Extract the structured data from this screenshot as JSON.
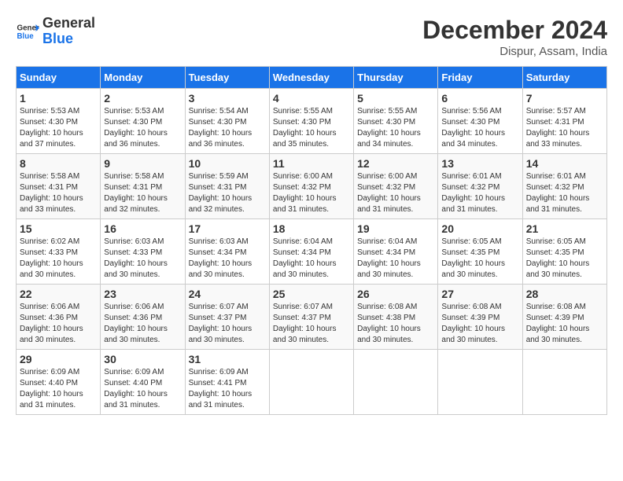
{
  "logo": {
    "line1": "General",
    "line2": "Blue"
  },
  "title": "December 2024",
  "subtitle": "Dispur, Assam, India",
  "days_header": [
    "Sunday",
    "Monday",
    "Tuesday",
    "Wednesday",
    "Thursday",
    "Friday",
    "Saturday"
  ],
  "weeks": [
    [
      {
        "day": "1",
        "sunrise": "5:53 AM",
        "sunset": "4:30 PM",
        "daylight": "10 hours and 37 minutes."
      },
      {
        "day": "2",
        "sunrise": "5:53 AM",
        "sunset": "4:30 PM",
        "daylight": "10 hours and 36 minutes."
      },
      {
        "day": "3",
        "sunrise": "5:54 AM",
        "sunset": "4:30 PM",
        "daylight": "10 hours and 36 minutes."
      },
      {
        "day": "4",
        "sunrise": "5:55 AM",
        "sunset": "4:30 PM",
        "daylight": "10 hours and 35 minutes."
      },
      {
        "day": "5",
        "sunrise": "5:55 AM",
        "sunset": "4:30 PM",
        "daylight": "10 hours and 34 minutes."
      },
      {
        "day": "6",
        "sunrise": "5:56 AM",
        "sunset": "4:30 PM",
        "daylight": "10 hours and 34 minutes."
      },
      {
        "day": "7",
        "sunrise": "5:57 AM",
        "sunset": "4:31 PM",
        "daylight": "10 hours and 33 minutes."
      }
    ],
    [
      {
        "day": "8",
        "sunrise": "5:58 AM",
        "sunset": "4:31 PM",
        "daylight": "10 hours and 33 minutes."
      },
      {
        "day": "9",
        "sunrise": "5:58 AM",
        "sunset": "4:31 PM",
        "daylight": "10 hours and 32 minutes."
      },
      {
        "day": "10",
        "sunrise": "5:59 AM",
        "sunset": "4:31 PM",
        "daylight": "10 hours and 32 minutes."
      },
      {
        "day": "11",
        "sunrise": "6:00 AM",
        "sunset": "4:32 PM",
        "daylight": "10 hours and 31 minutes."
      },
      {
        "day": "12",
        "sunrise": "6:00 AM",
        "sunset": "4:32 PM",
        "daylight": "10 hours and 31 minutes."
      },
      {
        "day": "13",
        "sunrise": "6:01 AM",
        "sunset": "4:32 PM",
        "daylight": "10 hours and 31 minutes."
      },
      {
        "day": "14",
        "sunrise": "6:01 AM",
        "sunset": "4:32 PM",
        "daylight": "10 hours and 31 minutes."
      }
    ],
    [
      {
        "day": "15",
        "sunrise": "6:02 AM",
        "sunset": "4:33 PM",
        "daylight": "10 hours and 30 minutes."
      },
      {
        "day": "16",
        "sunrise": "6:03 AM",
        "sunset": "4:33 PM",
        "daylight": "10 hours and 30 minutes."
      },
      {
        "day": "17",
        "sunrise": "6:03 AM",
        "sunset": "4:34 PM",
        "daylight": "10 hours and 30 minutes."
      },
      {
        "day": "18",
        "sunrise": "6:04 AM",
        "sunset": "4:34 PM",
        "daylight": "10 hours and 30 minutes."
      },
      {
        "day": "19",
        "sunrise": "6:04 AM",
        "sunset": "4:34 PM",
        "daylight": "10 hours and 30 minutes."
      },
      {
        "day": "20",
        "sunrise": "6:05 AM",
        "sunset": "4:35 PM",
        "daylight": "10 hours and 30 minutes."
      },
      {
        "day": "21",
        "sunrise": "6:05 AM",
        "sunset": "4:35 PM",
        "daylight": "10 hours and 30 minutes."
      }
    ],
    [
      {
        "day": "22",
        "sunrise": "6:06 AM",
        "sunset": "4:36 PM",
        "daylight": "10 hours and 30 minutes."
      },
      {
        "day": "23",
        "sunrise": "6:06 AM",
        "sunset": "4:36 PM",
        "daylight": "10 hours and 30 minutes."
      },
      {
        "day": "24",
        "sunrise": "6:07 AM",
        "sunset": "4:37 PM",
        "daylight": "10 hours and 30 minutes."
      },
      {
        "day": "25",
        "sunrise": "6:07 AM",
        "sunset": "4:37 PM",
        "daylight": "10 hours and 30 minutes."
      },
      {
        "day": "26",
        "sunrise": "6:08 AM",
        "sunset": "4:38 PM",
        "daylight": "10 hours and 30 minutes."
      },
      {
        "day": "27",
        "sunrise": "6:08 AM",
        "sunset": "4:39 PM",
        "daylight": "10 hours and 30 minutes."
      },
      {
        "day": "28",
        "sunrise": "6:08 AM",
        "sunset": "4:39 PM",
        "daylight": "10 hours and 30 minutes."
      }
    ],
    [
      {
        "day": "29",
        "sunrise": "6:09 AM",
        "sunset": "4:40 PM",
        "daylight": "10 hours and 31 minutes."
      },
      {
        "day": "30",
        "sunrise": "6:09 AM",
        "sunset": "4:40 PM",
        "daylight": "10 hours and 31 minutes."
      },
      {
        "day": "31",
        "sunrise": "6:09 AM",
        "sunset": "4:41 PM",
        "daylight": "10 hours and 31 minutes."
      },
      null,
      null,
      null,
      null
    ]
  ]
}
